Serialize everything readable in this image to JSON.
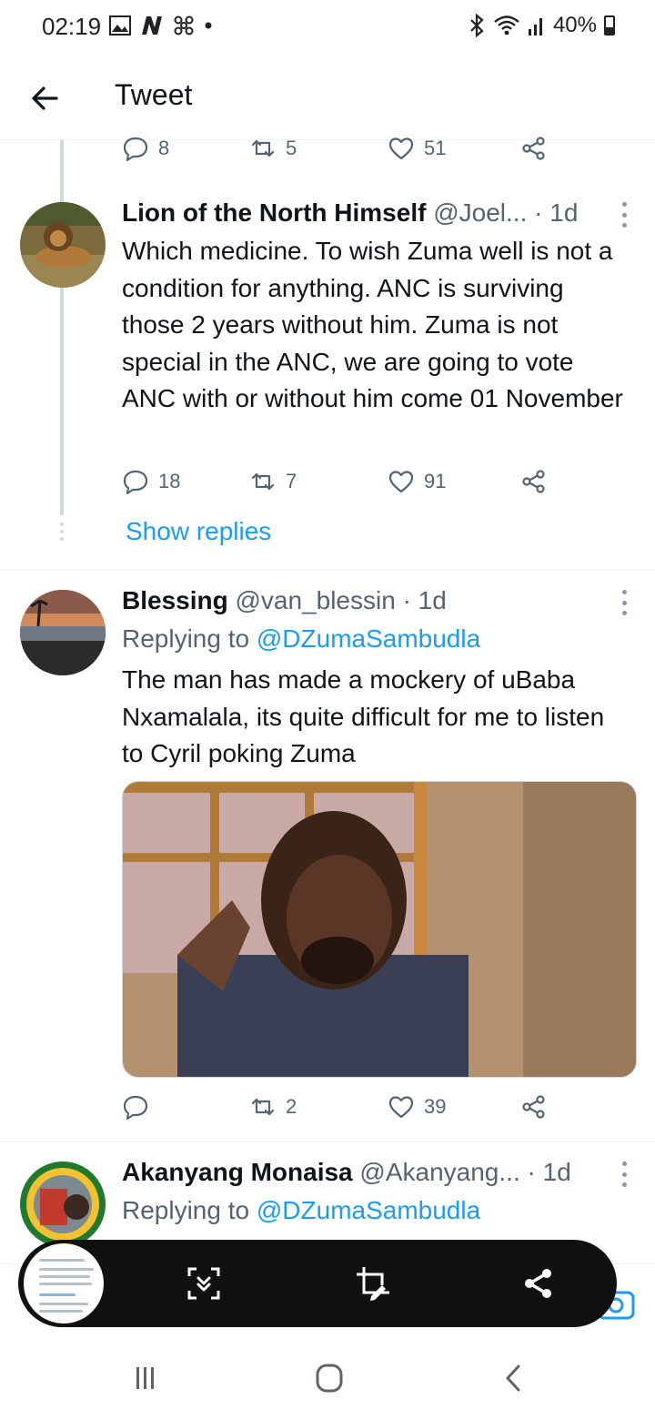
{
  "status": {
    "time": "02:19",
    "battery": "40%"
  },
  "header": {
    "title": "Tweet"
  },
  "top_actions": {
    "reply_count": "8",
    "retweet_count": "5",
    "like_count": "51"
  },
  "tweets": [
    {
      "name": "Lion of the North Himself",
      "handle": "@Joel...",
      "time": "· 1d",
      "text": "Which medicine. To wish Zuma well is not a condition for anything. ANC is surviving those 2 years without him. Zuma is not special in the ANC, we are going to vote ANC with or without him come 01 November",
      "reply_count": "18",
      "retweet_count": "7",
      "like_count": "91",
      "show_replies": "Show replies"
    },
    {
      "name": "Blessing",
      "handle": "@van_blessin",
      "time": "· 1d",
      "replying_prefix": "Replying to",
      "replying_to": "@DZumaSambudla",
      "text": "The man has made a mockery of uBaba Nxamalala, its quite difficult for me to listen to Cyril poking Zuma",
      "reply_count": "",
      "retweet_count": "2",
      "like_count": "39"
    },
    {
      "name": "Akanyang Monaisa",
      "handle": "@Akanyang...",
      "time": "· 1d",
      "replying_prefix": "Replying to",
      "replying_to": "@DZumaSambudla"
    }
  ],
  "colors": {
    "accent": "#1d9bf0",
    "secondary_text": "#536471",
    "divider": "#eff3f4"
  },
  "icons": [
    "back-arrow-icon",
    "reply-icon",
    "retweet-icon",
    "like-icon",
    "share-icon",
    "more-icon",
    "scroll-capture-icon",
    "crop-edit-icon",
    "camera-icon",
    "recents-icon",
    "home-icon",
    "back-icon"
  ]
}
